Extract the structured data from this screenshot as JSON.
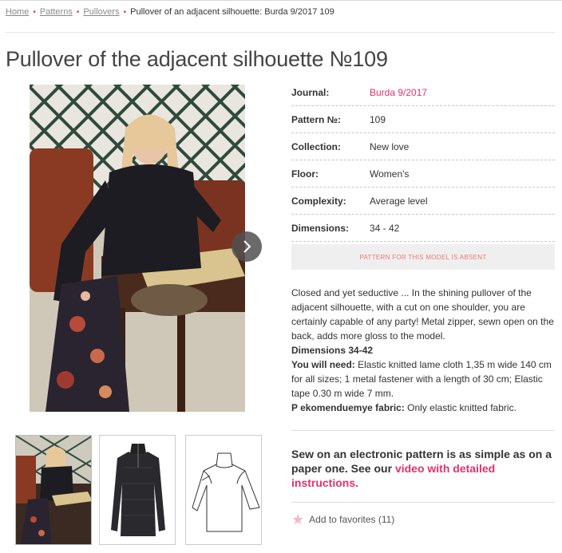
{
  "breadcrumb": {
    "home": "Home",
    "patterns": "Patterns",
    "pullovers": "Pullovers",
    "current": "Pullover of an adjacent silhouette: Burda 9/2017 109",
    "separator": "•"
  },
  "title": "Pullover of the adjacent silhouette №109",
  "specs": {
    "journal_label": "Journal:",
    "journal_value": "Burda 9/2017",
    "pattern_label": "Pattern №:",
    "pattern_value": "109",
    "collection_label": "Collection:",
    "collection_value": "New love",
    "floor_label": "Floor:",
    "floor_value": "Women's",
    "complexity_label": "Complexity:",
    "complexity_value": "Average level",
    "dimensions_label": "Dimensions:",
    "dimensions_value": "34 - 42"
  },
  "absent_notice": "PATTERN FOR THIS MODEL IS ABSENT",
  "description": {
    "intro": "Closed and yet seductive ... In the shining pullover of the adjacent silhouette, with a cut on one shoulder, you are certainly capable of any party! Metal zipper, sewn open on the back, adds more gloss to the model.",
    "dimensions_heading": "Dimensions 34-42",
    "need_label": "You will need:",
    "need_text": " Elastic knitted lame cloth 1,35 m wide 140 cm for all sizes; 1 metal fastener with a length of 30 cm; Elastic tape 0.30 m wide 7 mm.",
    "fabric_label": "P ekomenduemye fabric:",
    "fabric_text": " Only elastic knitted fabric."
  },
  "sew": {
    "text": "Sew on an electronic pattern is as simple as on a paper one. See our ",
    "link": "video with detailed instructions."
  },
  "favorites": {
    "label": "Add to favorites (11)",
    "icon": "star-icon"
  },
  "colors": {
    "accent": "#e0336c",
    "text": "#333333",
    "muted": "#888888",
    "notice_bg": "#efefef"
  }
}
